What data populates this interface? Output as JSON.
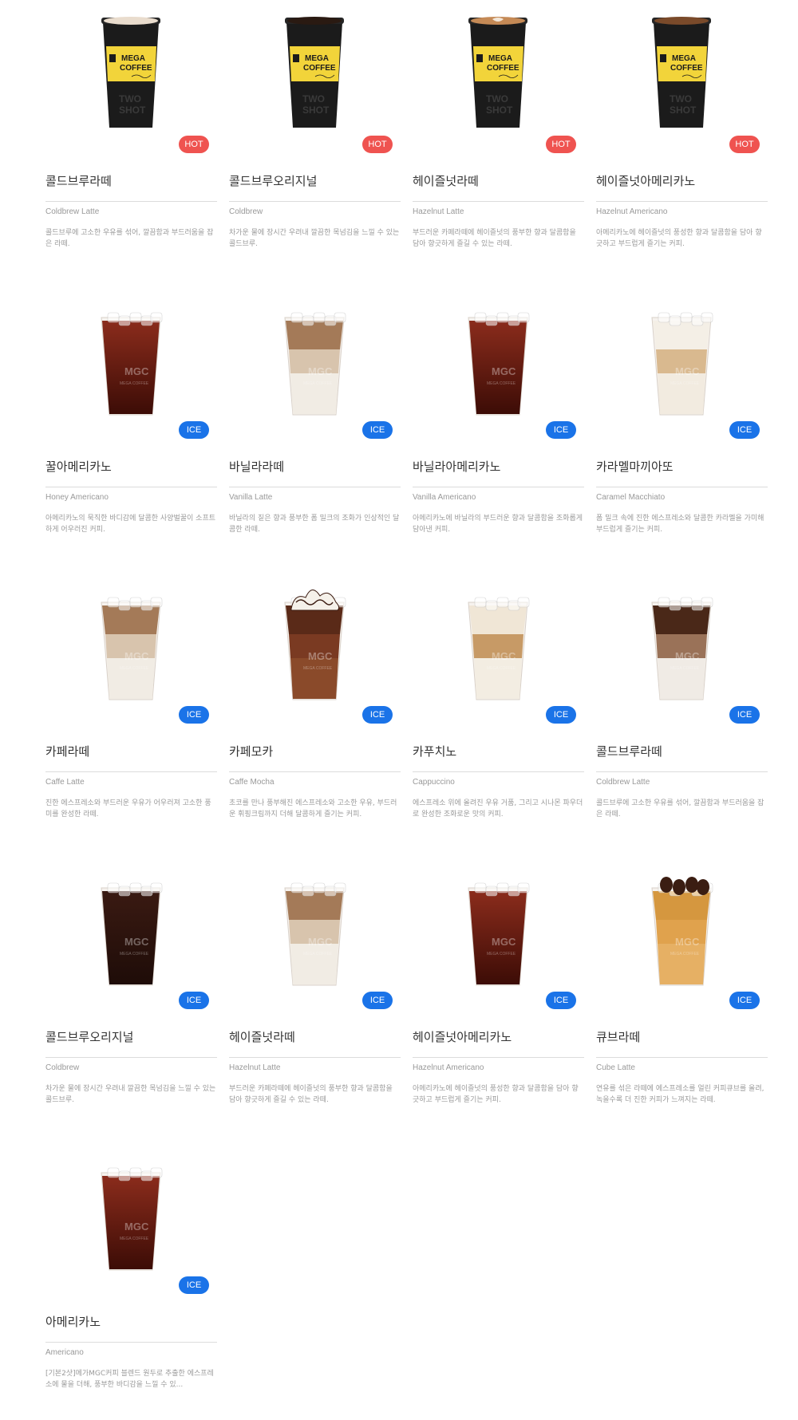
{
  "products": [
    {
      "name": "콜드브루라떼",
      "english": "Coldbrew Latte",
      "description": "콜드브루에 고소한 우유를 섞어, 깔끔함과 부드러움을 잡은 라떼.",
      "badge": "HOT",
      "cup": "hot-latte",
      "image_label": "cup-image"
    },
    {
      "name": "콜드브루오리지널",
      "english": "Coldbrew",
      "description": "차가운 물에 장시간 우려내 깔끔한 목넘김을 느낄 수 있는 콜드브루.",
      "badge": "HOT",
      "cup": "hot-black",
      "image_label": "cup-image"
    },
    {
      "name": "헤이즐넛라떼",
      "english": "Hazelnut Latte",
      "description": "부드러운 카페라떼에 헤이즐넛의 풍부한 향과 달콤함을 담아 향긋하게 즐길 수 있는 라떼.",
      "badge": "HOT",
      "cup": "hot-latteart",
      "image_label": "cup-image"
    },
    {
      "name": "헤이즐넛아메리카노",
      "english": "Hazelnut Americano",
      "description": "아메리카노에 헤이즐넛의 풍성한 향과 달콤함을 담아 향긋하고 부드럽게 즐기는 커피.",
      "badge": "HOT",
      "cup": "hot-crema",
      "image_label": "cup-image"
    },
    {
      "name": "꿀아메리카노",
      "english": "Honey Americano",
      "description": "아메리카노의 묵직한 바디감에 달콤한 사양벌꿀이 소프트하게 어우러진 커피.",
      "badge": "ICE",
      "cup": "ice-americano",
      "image_label": "cup-image"
    },
    {
      "name": "바닐라라떼",
      "english": "Vanilla Latte",
      "description": "바닐라의 짙은 향과 풍부한 폼 밀크의 조화가 인상적인 달콤한 라떼.",
      "badge": "ICE",
      "cup": "ice-latte",
      "image_label": "cup-image"
    },
    {
      "name": "바닐라아메리카노",
      "english": "Vanilla Americano",
      "description": "아메리카노에 바닐라의 부드러운 향과 달콤함을 조화롭게 담아낸 커피.",
      "badge": "ICE",
      "cup": "ice-americano",
      "image_label": "cup-image"
    },
    {
      "name": "카라멜마끼아또",
      "english": "Caramel Macchiato",
      "description": "폼 밀크 속에 진한 에스프레소와 달콤한 카라멜을 가미해 부드럽게 즐기는 커피.",
      "badge": "ICE",
      "cup": "ice-macchiato",
      "image_label": "cup-image"
    },
    {
      "name": "카페라떼",
      "english": "Caffe Latte",
      "description": "진한 에스프레소와 부드러운 우유가 어우러져 고소한 풍미를 완성한 라떼.",
      "badge": "ICE",
      "cup": "ice-latte",
      "image_label": "cup-image"
    },
    {
      "name": "카페모카",
      "english": "Caffe Mocha",
      "description": "초코를 만나 풍부해진 에스프레소와 고소한 우유, 부드러운 휘핑크림까지 더해 달콤하게 즐기는 커피.",
      "badge": "ICE",
      "cup": "ice-mocha",
      "image_label": "cup-image"
    },
    {
      "name": "카푸치노",
      "english": "Cappuccino",
      "description": "에스프레소 위에 올려진 우유 거품, 그리고 시나몬 파우더로 완성한 조화로운 맛의 커피.",
      "badge": "ICE",
      "cup": "ice-cappuccino",
      "image_label": "cup-image"
    },
    {
      "name": "콜드브루라떼",
      "english": "Coldbrew Latte",
      "description": "콜드브루에 고소한 우유를 섞어, 깔끔함과 부드러움을 잡은 라떼.",
      "badge": "ICE",
      "cup": "ice-coldbrew-latte",
      "image_label": "cup-image"
    },
    {
      "name": "콜드브루오리지널",
      "english": "Coldbrew",
      "description": "차가운 물에 장시간 우려내 깔끔한 목넘김을 느낄 수 있는 콜드브루.",
      "badge": "ICE",
      "cup": "ice-coldbrew",
      "image_label": "cup-image"
    },
    {
      "name": "헤이즐넛라떼",
      "english": "Hazelnut Latte",
      "description": "부드러운 카페라떼에 헤이즐넛의 풍부한 향과 달콤함을 담아 향긋하게 즐길 수 있는 라떼.",
      "badge": "ICE",
      "cup": "ice-latte",
      "image_label": "cup-image"
    },
    {
      "name": "헤이즐넛아메리카노",
      "english": "Hazelnut Americano",
      "description": "아메리카노에 헤이즐넛의 풍성한 향과 달콤함을 담아 향긋하고 부드럽게 즐기는 커피.",
      "badge": "ICE",
      "cup": "ice-americano",
      "image_label": "cup-image"
    },
    {
      "name": "큐브라떼",
      "english": "Cube Latte",
      "description": "연유를 섞은 라떼에 에스프레소를 얼린 커피큐브를 올려, 녹을수록 더 진한 커피가 느껴지는 라떼.",
      "badge": "ICE",
      "cup": "ice-cube",
      "image_label": "cup-image"
    },
    {
      "name": "아메리카노",
      "english": "Americano",
      "description": "[기본2샷]메가MGC커피 블렌드 원두로 추출한 에스프레소에 물을 더해, 풍부한 바디감을 느낄 수 있...",
      "badge": "ICE",
      "cup": "ice-americano",
      "image_label": "cup-image"
    }
  ],
  "colors": {
    "hot_badge": "#ef5350",
    "ice_badge": "#1a73e8",
    "mega_yellow": "#f2d43a"
  },
  "cup_print": {
    "brand_line1": "MEGA",
    "brand_line2": "COFFEE",
    "sleeve_text": "TWO SHOT",
    "ice_logo": "MGC",
    "ice_sub": "MEGA COFFEE"
  }
}
